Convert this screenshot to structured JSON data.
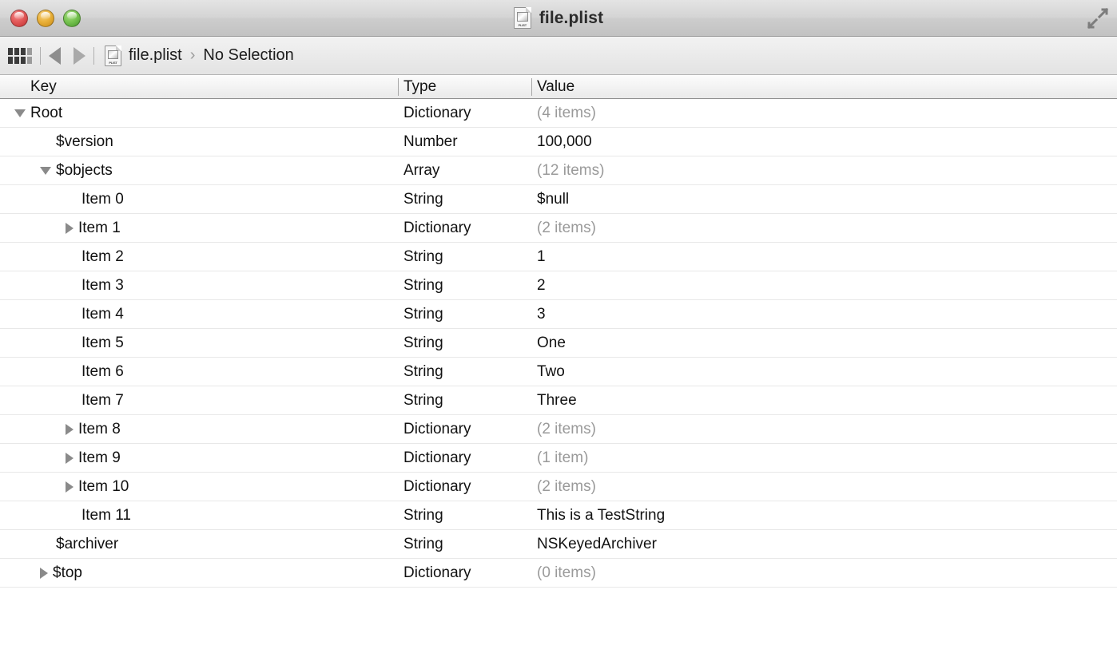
{
  "window": {
    "title": "file.plist",
    "title_icon": "plist-document-icon",
    "plist_icon_label": "PLIST",
    "fullscreen_icon": "fullscreen-expand-icon",
    "traffic_lights": [
      {
        "name": "close-button",
        "color": "#e35b5b"
      },
      {
        "name": "minimize-button",
        "color": "#eab23b"
      },
      {
        "name": "maximize-button",
        "color": "#79c552"
      }
    ]
  },
  "toolbar": {
    "grid_icon": "grid-view-icon",
    "back_arrow": "back-arrow-icon",
    "forward_arrow": "forward-arrow-icon",
    "breadcrumb": {
      "file_icon": "plist-document-icon",
      "file_name": "file.plist",
      "separator": "›",
      "selection": "No Selection"
    }
  },
  "table": {
    "columns": [
      {
        "key": "key",
        "label": "Key"
      },
      {
        "key": "type",
        "label": "Type"
      },
      {
        "key": "value",
        "label": "Value"
      }
    ],
    "rows": [
      {
        "key": "Root",
        "type": "Dictionary",
        "value": "(4 items)",
        "muted": true,
        "indent": 0,
        "disclosure": "open"
      },
      {
        "key": "$version",
        "type": "Number",
        "value": "100,000",
        "muted": false,
        "indent": 1,
        "disclosure": "none"
      },
      {
        "key": "$objects",
        "type": "Array",
        "value": "(12 items)",
        "muted": true,
        "indent": 1,
        "disclosure": "open"
      },
      {
        "key": "Item 0",
        "type": "String",
        "value": "$null",
        "muted": false,
        "indent": 2,
        "disclosure": "none"
      },
      {
        "key": "Item 1",
        "type": "Dictionary",
        "value": "(2 items)",
        "muted": true,
        "indent": 2,
        "disclosure": "closed"
      },
      {
        "key": "Item 2",
        "type": "String",
        "value": "1",
        "muted": false,
        "indent": 2,
        "disclosure": "none"
      },
      {
        "key": "Item 3",
        "type": "String",
        "value": "2",
        "muted": false,
        "indent": 2,
        "disclosure": "none"
      },
      {
        "key": "Item 4",
        "type": "String",
        "value": "3",
        "muted": false,
        "indent": 2,
        "disclosure": "none"
      },
      {
        "key": "Item 5",
        "type": "String",
        "value": "One",
        "muted": false,
        "indent": 2,
        "disclosure": "none"
      },
      {
        "key": "Item 6",
        "type": "String",
        "value": "Two",
        "muted": false,
        "indent": 2,
        "disclosure": "none"
      },
      {
        "key": "Item 7",
        "type": "String",
        "value": "Three",
        "muted": false,
        "indent": 2,
        "disclosure": "none"
      },
      {
        "key": "Item 8",
        "type": "Dictionary",
        "value": "(2 items)",
        "muted": true,
        "indent": 2,
        "disclosure": "closed"
      },
      {
        "key": "Item 9",
        "type": "Dictionary",
        "value": "(1 item)",
        "muted": true,
        "indent": 2,
        "disclosure": "closed"
      },
      {
        "key": "Item 10",
        "type": "Dictionary",
        "value": "(2 items)",
        "muted": true,
        "indent": 2,
        "disclosure": "closed"
      },
      {
        "key": "Item 11",
        "type": "String",
        "value": "This is a TestString",
        "muted": false,
        "indent": 2,
        "disclosure": "none"
      },
      {
        "key": "$archiver",
        "type": "String",
        "value": "NSKeyedArchiver",
        "muted": false,
        "indent": 1,
        "disclosure": "none"
      },
      {
        "key": "$top",
        "type": "Dictionary",
        "value": "(0 items)",
        "muted": true,
        "indent": 1,
        "disclosure": "closed"
      }
    ]
  },
  "colors": {
    "titlebar_top": "#e4e4e4",
    "titlebar_bottom": "#c2c2c2",
    "row_separator": "#e8e8e8",
    "muted_text": "#9a9a9a",
    "text": "#121212",
    "disclosure": "#8a8a8a"
  }
}
